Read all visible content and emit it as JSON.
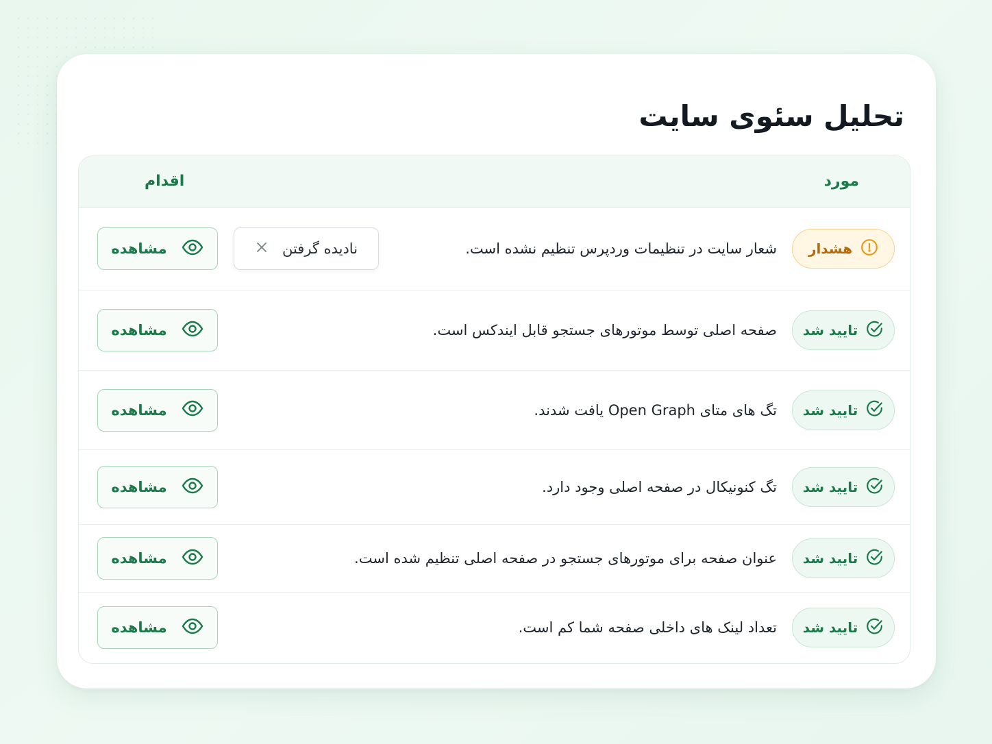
{
  "page": {
    "title": "تحلیل سئوی سایت"
  },
  "table": {
    "headers": {
      "item": "مورد",
      "action": "اقدام"
    },
    "rows": [
      {
        "status": "warning",
        "status_label": "هشدار",
        "status_icon": "exclamation-circle-icon",
        "description": "شعار سایت در تنظیمات وردپرس تنظیم نشده است.",
        "view_label": "مشاهده",
        "ignore_label": "نادیده گرفتن"
      },
      {
        "status": "passed",
        "status_label": "تایید شد",
        "status_icon": "check-circle-icon",
        "description": "صفحه اصلی توسط موتورهای جستجو قابل ایندکس است.",
        "view_label": "مشاهده"
      },
      {
        "status": "passed",
        "status_label": "تایید شد",
        "status_icon": "check-circle-icon",
        "description": "تگ های متای Open Graph یافت شدند.",
        "view_label": "مشاهده"
      },
      {
        "status": "passed",
        "status_label": "تایید شد",
        "status_icon": "check-circle-icon",
        "description": "تگ کنونیکال در صفحه اصلی وجود دارد.",
        "view_label": "مشاهده"
      },
      {
        "status": "passed",
        "status_label": "تایید شد",
        "status_icon": "check-circle-icon",
        "description": "عنوان صفحه برای موتورهای جستجو در صفحه اصلی تنظیم شده است.",
        "view_label": "مشاهده"
      },
      {
        "status": "passed",
        "status_label": "تایید شد",
        "status_icon": "check-circle-icon",
        "description": "تعداد لینک های داخلی صفحه شما کم است.",
        "view_label": "مشاهده"
      }
    ]
  },
  "colors": {
    "accent": "#1b7a4a",
    "warning": "#b46a0c",
    "background": "#e9f7ef"
  }
}
